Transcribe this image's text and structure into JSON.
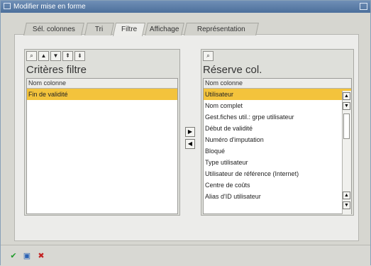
{
  "window": {
    "title": "Modifier mise en forme"
  },
  "tabs": [
    {
      "label": "Sél. colonnes"
    },
    {
      "label": "Tri"
    },
    {
      "label": "Filtre"
    },
    {
      "label": "Affichage"
    },
    {
      "label": "Représentation"
    }
  ],
  "active_tab": "Filtre",
  "left_panel": {
    "title": "Critères filtre",
    "column_header": "Nom colonne",
    "rows": [
      "Fin de validité"
    ],
    "selected_index": 0,
    "toolbar_icons": [
      "find-icon",
      "move-up-icon",
      "move-down-icon",
      "move-top-icon",
      "move-bottom-icon"
    ]
  },
  "right_panel": {
    "title": "Réserve col.",
    "column_header": "Nom colonne",
    "rows": [
      "Utilisateur",
      "Nom complet",
      "Gest.fiches util.: grpe utilisateur",
      "Début de validité",
      "Numéro d'imputation",
      "Bloqué",
      "Type utilisateur",
      "Utilisateur de référence (Internet)",
      "Centre de coûts",
      "Alias d'ID utilisateur"
    ],
    "selected_index": 0,
    "toolbar_icons": [
      "find-icon"
    ]
  },
  "transfer_buttons": {
    "to_left_icon": "arrow-right-icon",
    "to_right_icon": "arrow-left-icon"
  },
  "footer": {
    "icons": [
      "confirm-icon",
      "save-icon",
      "cancel-icon"
    ]
  },
  "colors": {
    "selection": "#f3c33c",
    "titlebar": "#5a7aa4"
  }
}
